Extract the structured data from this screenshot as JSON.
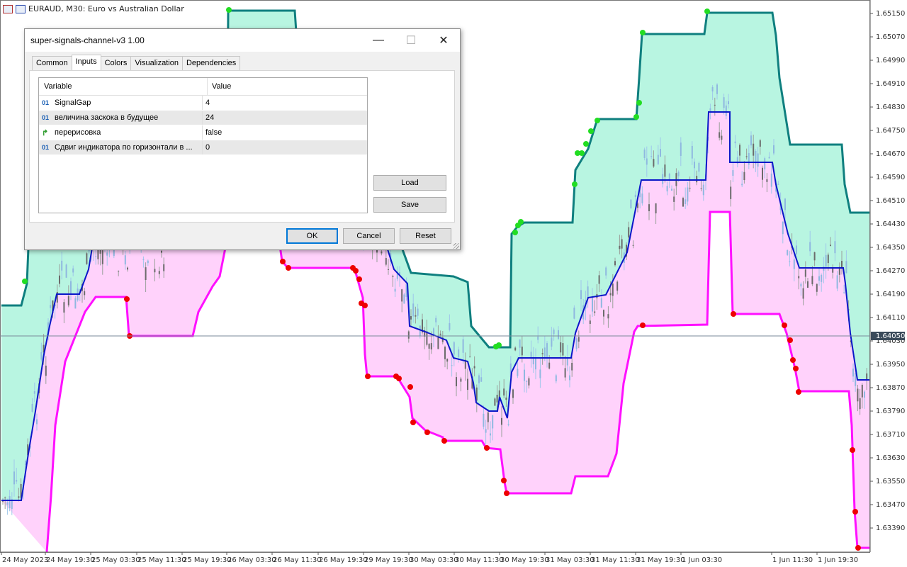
{
  "chart": {
    "symbol_label": "EURAUD, M30:  Euro vs Australian Dollar",
    "current_price": "1.64050",
    "price_ticks": [
      "1.65150",
      "1.65070",
      "1.64990",
      "1.64910",
      "1.64830",
      "1.64750",
      "1.64670",
      "1.64590",
      "1.64510",
      "1.64430",
      "1.64350",
      "1.64270",
      "1.64190",
      "1.64110",
      "1.64030",
      "1.63950",
      "1.63870",
      "1.63790",
      "1.63710",
      "1.63630",
      "1.63550",
      "1.63470",
      "1.63390"
    ],
    "time_ticks": [
      "24 May 2023",
      "24 May 19:30",
      "25 May 03:30",
      "25 May 11:30",
      "25 May 19:30",
      "26 May 03:30",
      "26 May 11:30",
      "26 May 19:30",
      "29 May 19:30",
      "30 May 03:30",
      "30 May 11:30",
      "30 May 19:30",
      "31 May 03:30",
      "31 May 11:30",
      "31 May 19:30",
      "1 Jun 03:30",
      "1 Jun 11:30",
      "1 Jun 19:30"
    ],
    "colors": {
      "upper_line": "#0f7f7f",
      "upper_fill": "#b8f5e1",
      "lower_line": "#ff10ff",
      "lower_fill": "#ffd2fb",
      "mid_line": "#0b16c8",
      "buy_signal": "#22dd22",
      "sell_signal": "#ee0000"
    }
  },
  "dialog": {
    "title": "super-signals-channel-v3 1.00",
    "window_buttons": {
      "minimize": "—",
      "maximize": "☐",
      "close": "✕"
    },
    "tabs": [
      "Common",
      "Inputs",
      "Colors",
      "Visualization",
      "Dependencies"
    ],
    "active_tab": "Inputs",
    "grid": {
      "headers": {
        "variable": "Variable",
        "value": "Value"
      },
      "rows": [
        {
          "icon": "01",
          "type": "int",
          "name": "SignalGap",
          "value": "4"
        },
        {
          "icon": "01",
          "type": "int",
          "name": "величина заскока в будущее",
          "value": "24"
        },
        {
          "icon": "↱",
          "type": "bool",
          "name": "перерисовка",
          "value": "false"
        },
        {
          "icon": "01",
          "type": "int",
          "name": "Сдвиг индикатора по горизонтали в ...",
          "value": "0"
        }
      ]
    },
    "buttons": {
      "load": "Load",
      "save": "Save",
      "ok": "OK",
      "cancel": "Cancel",
      "reset": "Reset"
    }
  }
}
